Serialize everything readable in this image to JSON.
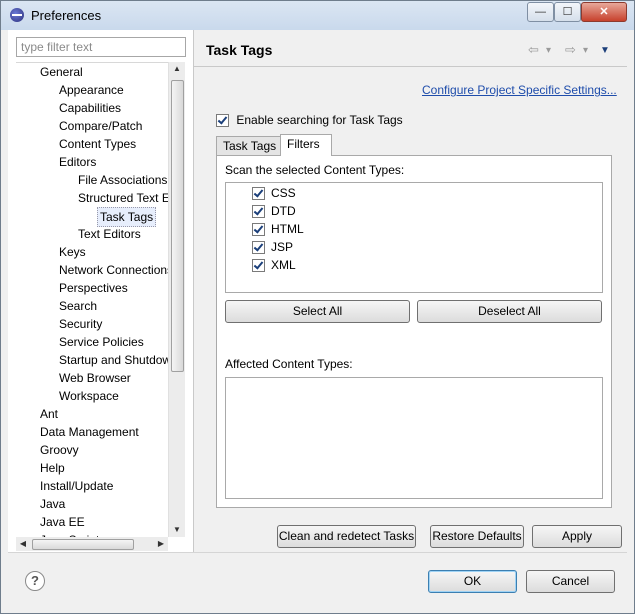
{
  "window": {
    "title": "Preferences",
    "min_glyph": "—",
    "max_glyph": "☐",
    "close_glyph": "✕"
  },
  "filter": {
    "placeholder": "type filter text"
  },
  "tree": [
    {
      "label": "General",
      "depth": 0
    },
    {
      "label": "Appearance",
      "depth": 1
    },
    {
      "label": "Capabilities",
      "depth": 1
    },
    {
      "label": "Compare/Patch",
      "depth": 1
    },
    {
      "label": "Content Types",
      "depth": 1
    },
    {
      "label": "Editors",
      "depth": 1
    },
    {
      "label": "File Associations",
      "depth": 2
    },
    {
      "label": "Structured Text Editors",
      "depth": 2
    },
    {
      "label": "Task Tags",
      "depth": 3,
      "selected": true
    },
    {
      "label": "Text Editors",
      "depth": 2
    },
    {
      "label": "Keys",
      "depth": 1
    },
    {
      "label": "Network Connections",
      "depth": 1
    },
    {
      "label": "Perspectives",
      "depth": 1
    },
    {
      "label": "Search",
      "depth": 1
    },
    {
      "label": "Security",
      "depth": 1
    },
    {
      "label": "Service Policies",
      "depth": 1
    },
    {
      "label": "Startup and Shutdown",
      "depth": 1
    },
    {
      "label": "Web Browser",
      "depth": 1
    },
    {
      "label": "Workspace",
      "depth": 1
    },
    {
      "label": "Ant",
      "depth": 0
    },
    {
      "label": "Data Management",
      "depth": 0
    },
    {
      "label": "Groovy",
      "depth": 0
    },
    {
      "label": "Help",
      "depth": 0
    },
    {
      "label": "Install/Update",
      "depth": 0
    },
    {
      "label": "Java",
      "depth": 0
    },
    {
      "label": "Java EE",
      "depth": 0
    },
    {
      "label": "Java Script",
      "depth": 0
    }
  ],
  "page": {
    "title": "Task Tags",
    "back_glyph": "⇦",
    "forward_glyph": "⇨",
    "dropdown_glyph": "▾",
    "menu_glyph": "▼",
    "configure_link": "Configure Project Specific Settings...",
    "enable_label": "Enable searching for Task Tags",
    "enable_checked": true,
    "tabs": [
      "Task Tags",
      "Filters"
    ],
    "active_tab": "Filters",
    "scan_label": "Scan the selected Content Types:",
    "content_types": [
      {
        "label": "CSS",
        "checked": true
      },
      {
        "label": "DTD",
        "checked": true
      },
      {
        "label": "HTML",
        "checked": true
      },
      {
        "label": "JSP",
        "checked": true
      },
      {
        "label": "XML",
        "checked": true
      }
    ],
    "select_all": "Select All",
    "deselect_all": "Deselect All",
    "affected_label": "Affected Content Types:",
    "clean_button": "Clean and redetect Tasks",
    "restore_button": "Restore Defaults",
    "apply_button": "Apply"
  },
  "footer": {
    "help_glyph": "?",
    "ok_button": "OK",
    "cancel_button": "Cancel"
  },
  "scroll": {
    "up": "▲",
    "down": "▼",
    "left": "◀",
    "right": "▶"
  }
}
